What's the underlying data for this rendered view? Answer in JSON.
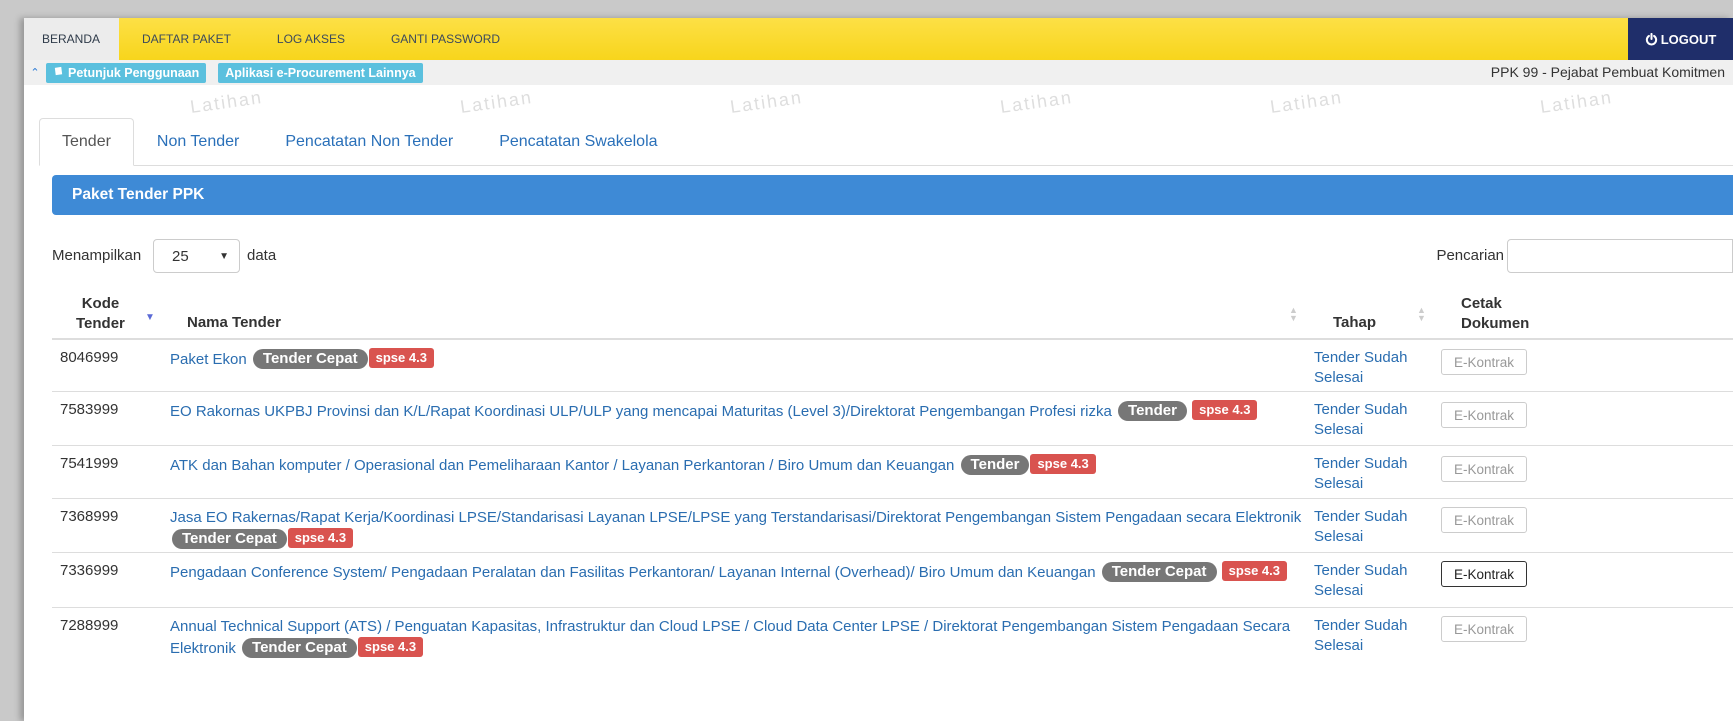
{
  "nav": {
    "items": [
      "BERANDA",
      "DAFTAR PAKET",
      "LOG AKSES",
      "GANTI PASSWORD"
    ],
    "logout_label": "LOGOUT"
  },
  "subbar": {
    "help_label": "Petunjuk Penggunaan",
    "other_apps_label": "Aplikasi e-Procurement Lainnya",
    "role_text": "PPK 99 - Pejabat Pembuat Komitmen"
  },
  "watermark_text": "Latihan",
  "tabs": [
    "Tender",
    "Non Tender",
    "Pencatatan Non Tender",
    "Pencatatan Swakelola"
  ],
  "panel_title": "Paket Tender PPK",
  "controls": {
    "show_label": "Menampilkan",
    "page_length": "25",
    "data_label": "data",
    "search_label": "Pencarian"
  },
  "table": {
    "headers": {
      "kode_line1": "Kode",
      "kode_line2": "Tender",
      "nama": "Nama Tender",
      "tahap": "Tahap",
      "cetak_line1": "Cetak",
      "cetak_line2": "Dokumen"
    },
    "rows": [
      {
        "kode": "8046999",
        "nama": "Paket Ekon",
        "badge": "Tender Cepat",
        "version": "spse 4.3",
        "tahap": "Tender Sudah Selesai",
        "action": "E-Kontrak"
      },
      {
        "kode": "7583999",
        "nama": "EO Rakornas UKPBJ Provinsi dan K/L/Rapat Koordinasi ULP/ULP yang mencapai Maturitas (Level 3)/Direktorat Pengembangan Profesi rizka",
        "badge": "Tender",
        "version": "spse 4.3",
        "tahap": "Tender Sudah Selesai",
        "action": "E-Kontrak"
      },
      {
        "kode": "7541999",
        "nama": "ATK dan Bahan komputer / Operasional dan Pemeliharaan Kantor / Layanan Perkantoran / Biro Umum dan Keuangan",
        "badge": "Tender",
        "version": "spse 4.3",
        "tahap": "Tender Sudah Selesai",
        "action": "E-Kontrak"
      },
      {
        "kode": "7368999",
        "nama": "Jasa EO Rakernas/Rapat Kerja/Koordinasi LPSE/Standarisasi Layanan LPSE/LPSE yang Terstandarisasi/Direktorat Pengembangan Sistem Pengadaan secara Elektronik",
        "badge": "Tender Cepat",
        "version": "spse 4.3",
        "tahap": "Tender Sudah Selesai",
        "action": "E-Kontrak"
      },
      {
        "kode": "7336999",
        "nama": "Pengadaan Conference System/ Pengadaan Peralatan dan Fasilitas Perkantoran/ Layanan Internal (Overhead)/ Biro Umum dan Keuangan",
        "badge": "Tender Cepat",
        "version": "spse 4.3",
        "tahap": "Tender Sudah Selesai",
        "action": "E-Kontrak"
      },
      {
        "kode": "7288999",
        "nama": "Annual Technical Support (ATS) / Penguatan Kapasitas, Infrastruktur dan Cloud LPSE / Cloud Data Center LPSE / Direktorat Pengembangan Sistem Pengadaan Secara Elektronik",
        "badge": "Tender Cepat",
        "version": "spse 4.3",
        "tahap": "Tender Sudah Selesai",
        "action": "E-Kontrak"
      }
    ]
  },
  "colors": {
    "nav_bg": "#fde046",
    "logout_bg": "#1f2e6a",
    "panel_bg": "#3e8ad6",
    "link": "#2a6db0",
    "badge_gray": "#777777",
    "badge_red": "#d9534f",
    "pill_blue": "#5bc0de"
  }
}
